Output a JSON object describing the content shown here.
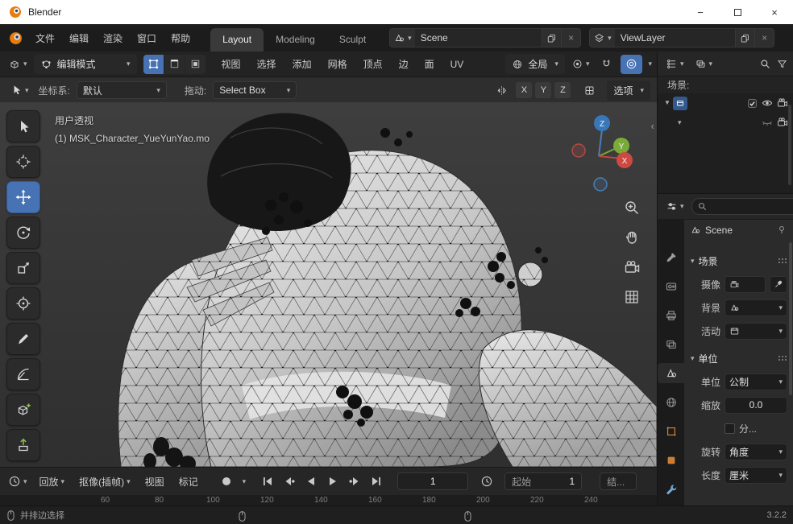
{
  "icons": {
    "chevron_down": "▾",
    "triangle_down": "▼",
    "chevron_left_small": "‹",
    "close": "×",
    "minimize": "−"
  },
  "titlebar": {
    "title": "Blender"
  },
  "topbar": {
    "menus": [
      "文件",
      "编辑",
      "渲染",
      "窗口",
      "帮助"
    ],
    "workspaces": [
      "Layout",
      "Modeling",
      "Sculpt"
    ],
    "scene_value": "Scene",
    "view_layer_value": "ViewLayer"
  },
  "tool_header": {
    "mode_label": "编辑模式",
    "menus": [
      "视图",
      "选择",
      "添加",
      "网格",
      "顶点",
      "边",
      "面",
      "UV"
    ],
    "orientation_value": "全局"
  },
  "tool_settings": {
    "transform_label": "坐标系:",
    "transform_value": "默认",
    "drag_label": "拖动:",
    "drag_value": "Select Box",
    "axes": [
      "X",
      "Y",
      "Z"
    ],
    "options_label": "选项"
  },
  "viewport": {
    "perspective_label": "用户透视",
    "object_label": "(1) MSK_Character_YueYunYao.mo",
    "gizmo": {
      "x": "X",
      "y": "Y",
      "z": "Z"
    }
  },
  "outliner": {
    "scene_filter_label": "场景:"
  },
  "properties": {
    "breadcrumb": "Scene",
    "scene_section_title": "场景",
    "camera_label": "摄像",
    "background_label": "背景",
    "active_label": "活动",
    "units_section_title": "单位",
    "unit_label": "单位",
    "unit_value": "公制",
    "scale_label": "缩放",
    "scale_value": "0.0",
    "separate_label": "分...",
    "rotation_label": "旋转",
    "rotation_value": "角度",
    "length_label": "长度",
    "length_value": "厘米"
  },
  "timeline": {
    "playback_label": "回放",
    "keying_label": "抠像(插帧)",
    "view_label": "视图",
    "marker_label": "标记",
    "current_frame": "1",
    "start_label": "起始",
    "start_value": "1",
    "end_label": "结...",
    "ruler": [
      "60",
      "80",
      "100",
      "120",
      "140",
      "160",
      "180",
      "200",
      "220",
      "240"
    ]
  },
  "statusbar": {
    "hint": "并排边选择",
    "version": "3.2.2"
  }
}
